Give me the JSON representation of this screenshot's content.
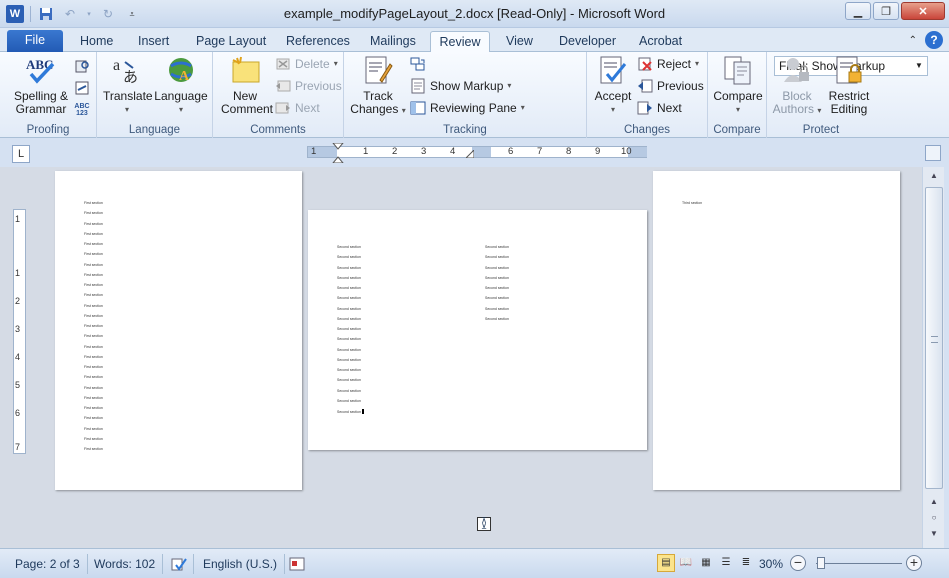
{
  "window": {
    "title": "example_modifyPageLayout_2.docx [Read-Only]  -  Microsoft Word",
    "app_icon": "W",
    "controls": [
      "minimize",
      "maximize",
      "close"
    ]
  },
  "tabs": [
    "File",
    "Home",
    "Insert",
    "Page Layout",
    "References",
    "Mailings",
    "Review",
    "View",
    "Developer",
    "Acrobat"
  ],
  "active_tab": "Review",
  "ribbon": {
    "proofing": {
      "label": "Proofing",
      "spelling": "Spelling &",
      "grammar": "Grammar"
    },
    "language": {
      "label": "Language",
      "translate": "Translate",
      "language": "Language"
    },
    "comments": {
      "label": "Comments",
      "new": "New",
      "comment": "Comment",
      "delete": "Delete",
      "previous": "Previous",
      "next": "Next"
    },
    "tracking": {
      "label": "Tracking",
      "track": "Track",
      "changes": "Changes",
      "markup_option": "Final: Show Markup",
      "show_markup": "Show Markup",
      "reviewing_pane": "Reviewing Pane"
    },
    "changes": {
      "label": "Changes",
      "accept": "Accept",
      "reject": "Reject",
      "previous": "Previous",
      "next": "Next"
    },
    "compare": {
      "label": "Compare",
      "compare": "Compare"
    },
    "protect": {
      "label": "Protect",
      "block": "Block",
      "authors": "Authors",
      "restrict": "Restrict",
      "editing": "Editing"
    }
  },
  "ruler": {
    "ticks": [
      "1",
      "1",
      "2",
      "3",
      "4",
      "6",
      "7",
      "8",
      "9",
      "10"
    ],
    "vticks": [
      "1",
      "1",
      "2",
      "3",
      "4",
      "5",
      "6",
      "7"
    ]
  },
  "document": {
    "page1_lines": [
      "First section",
      "First section",
      "First section",
      "First section",
      "First section",
      "First section",
      "First section",
      "First section",
      "First section",
      "First section",
      "First section",
      "First section",
      "First section",
      "First section",
      "First section",
      "First section",
      "First section",
      "First section",
      "First section",
      "First section",
      "First section",
      "First section",
      "First section",
      "First section",
      "First section"
    ],
    "page2_col1": [
      "Second section",
      "Second section",
      "Second section",
      "Second section",
      "Second section",
      "Second section",
      "Second section",
      "Second section",
      "Second section",
      "Second section",
      "Second section",
      "Second section",
      "Second section",
      "Second section",
      "Second section",
      "Second section",
      "Second section"
    ],
    "page2_col2": [
      "Second section",
      "Second section",
      "Second section",
      "Second section",
      "Second section",
      "Second section",
      "Second section",
      "Second section"
    ],
    "page3_lines": [
      "Third section"
    ]
  },
  "status": {
    "page": "Page: 2 of 3",
    "words": "Words: 102",
    "language": "English (U.S.)",
    "zoom": "30%"
  }
}
